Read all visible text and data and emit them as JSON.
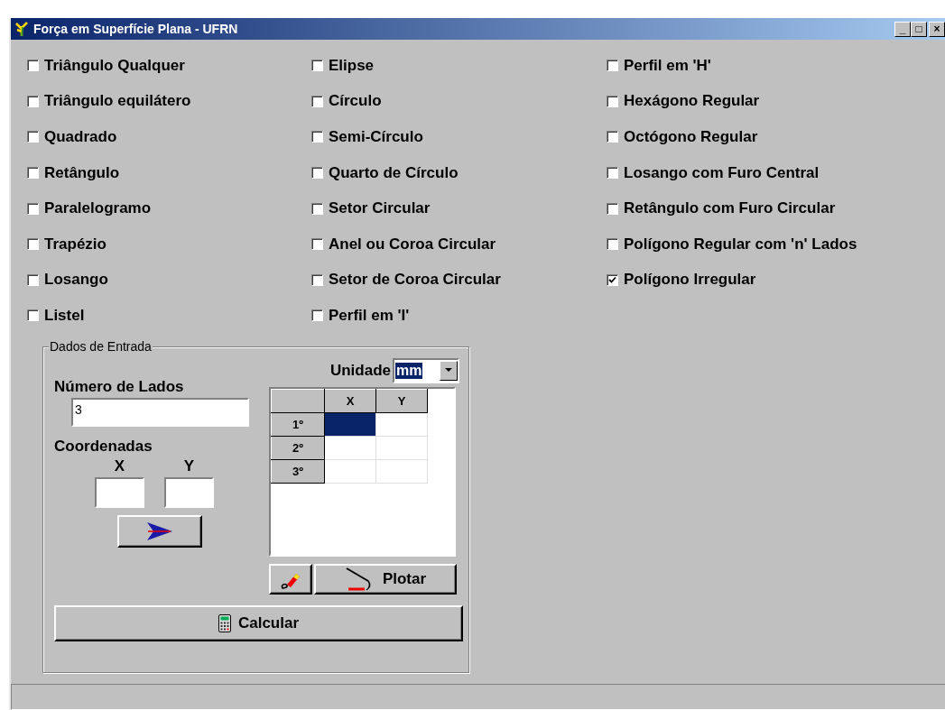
{
  "window": {
    "title": "Força em Superfície Plana - UFRN",
    "controls": [
      "_",
      "□",
      "×"
    ]
  },
  "shape_columns": [
    [
      {
        "label": "Triângulo Qualquer",
        "checked": false
      },
      {
        "label": "Triângulo equilátero",
        "checked": false
      },
      {
        "label": "Quadrado",
        "checked": false
      },
      {
        "label": "Retângulo",
        "checked": false
      },
      {
        "label": "Paralelogramo",
        "checked": false
      },
      {
        "label": "Trapézio",
        "checked": false
      },
      {
        "label": "Losango",
        "checked": false
      },
      {
        "label": "Listel",
        "checked": false
      }
    ],
    [
      {
        "label": "Elipse",
        "checked": false
      },
      {
        "label": "Círculo",
        "checked": false
      },
      {
        "label": "Semi-Círculo",
        "checked": false
      },
      {
        "label": "Quarto de Círculo",
        "checked": false
      },
      {
        "label": "Setor Circular",
        "checked": false
      },
      {
        "label": "Anel ou Coroa Circular",
        "checked": false
      },
      {
        "label": "Setor de Coroa Circular",
        "checked": false
      },
      {
        "label": "Perfil em 'I'",
        "checked": false
      }
    ],
    [
      {
        "label": "Perfil em 'H'",
        "checked": false
      },
      {
        "label": "Hexágono Regular",
        "checked": false
      },
      {
        "label": "Octógono Regular",
        "checked": false
      },
      {
        "label": "Losango com Furo Central",
        "checked": false
      },
      {
        "label": "Retângulo com Furo Circular",
        "checked": false
      },
      {
        "label": "Polígono Regular com 'n' Lados",
        "checked": false
      },
      {
        "label": "Polígono Irregular",
        "checked": true
      }
    ]
  ],
  "input_group": {
    "title": "Dados de Entrada",
    "unit_label": "Unidade",
    "unit_value": "mm",
    "sides_label": "Número de Lados",
    "sides_value": "3",
    "coords_label": "Coordenadas",
    "x_label": "X",
    "y_label": "Y",
    "grid": {
      "columns": [
        "X",
        "Y"
      ],
      "rows": [
        {
          "label": "1º",
          "cells": [
            {
              "selected": true
            },
            {
              "selected": false
            }
          ]
        },
        {
          "label": "2º",
          "cells": [
            {
              "selected": false
            },
            {
              "selected": false
            }
          ]
        },
        {
          "label": "3º",
          "cells": [
            {
              "selected": false
            },
            {
              "selected": false
            }
          ]
        }
      ]
    },
    "plot_button": "Plotar",
    "calculate_button": "Calcular"
  }
}
